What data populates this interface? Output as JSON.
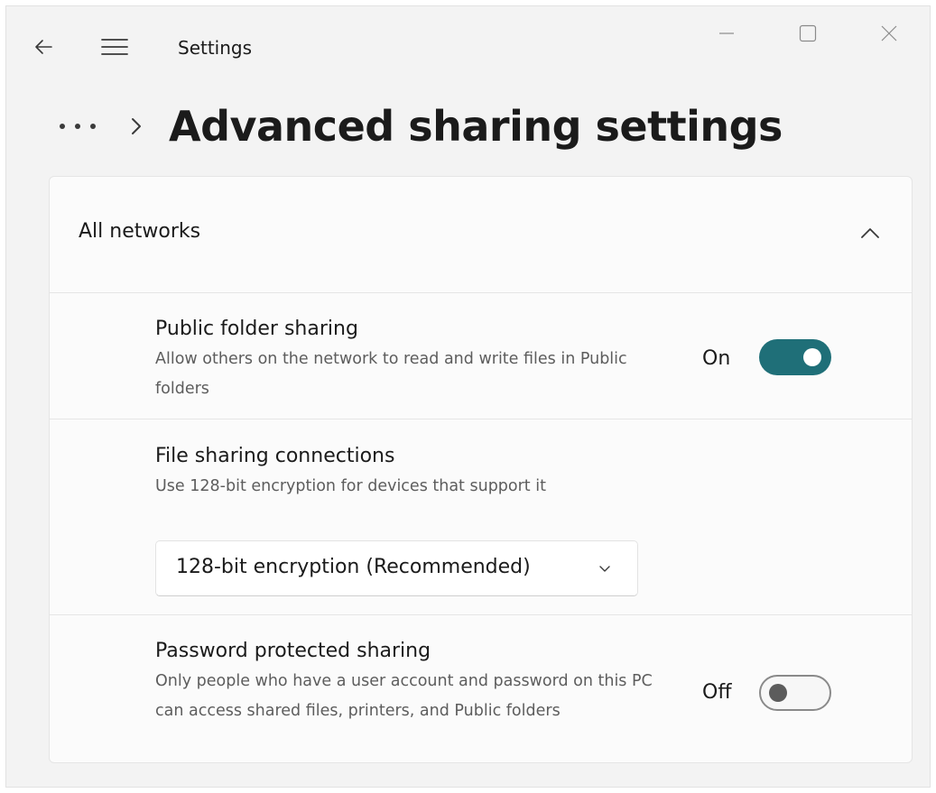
{
  "window": {
    "app_title": "Settings",
    "icons": {
      "back": "back-arrow-icon",
      "menu": "hamburger-menu-icon",
      "minimize": "minimize-icon",
      "maximize": "maximize-icon",
      "close": "close-icon"
    }
  },
  "header": {
    "breadcrumb_more": "•••",
    "page_title": "Advanced sharing settings"
  },
  "section": {
    "title": "All networks",
    "expanded": true,
    "settings": [
      {
        "title": "Public folder sharing",
        "description": "Allow others on the network to read and write files in Public folders",
        "state_label": "On",
        "enabled": true
      },
      {
        "title": "File sharing connections",
        "description": "Use 128-bit encryption for devices that support it",
        "dropdown_value": "128-bit encryption (Recommended)"
      },
      {
        "title": "Password protected sharing",
        "description": "Only people who have a user account and password on this PC can access shared files, printers, and Public folders",
        "state_label": "Off",
        "enabled": false
      }
    ]
  },
  "colors": {
    "accent": "#1f6f78",
    "window_bg": "#f3f3f3",
    "card_bg": "#fbfbfb"
  }
}
